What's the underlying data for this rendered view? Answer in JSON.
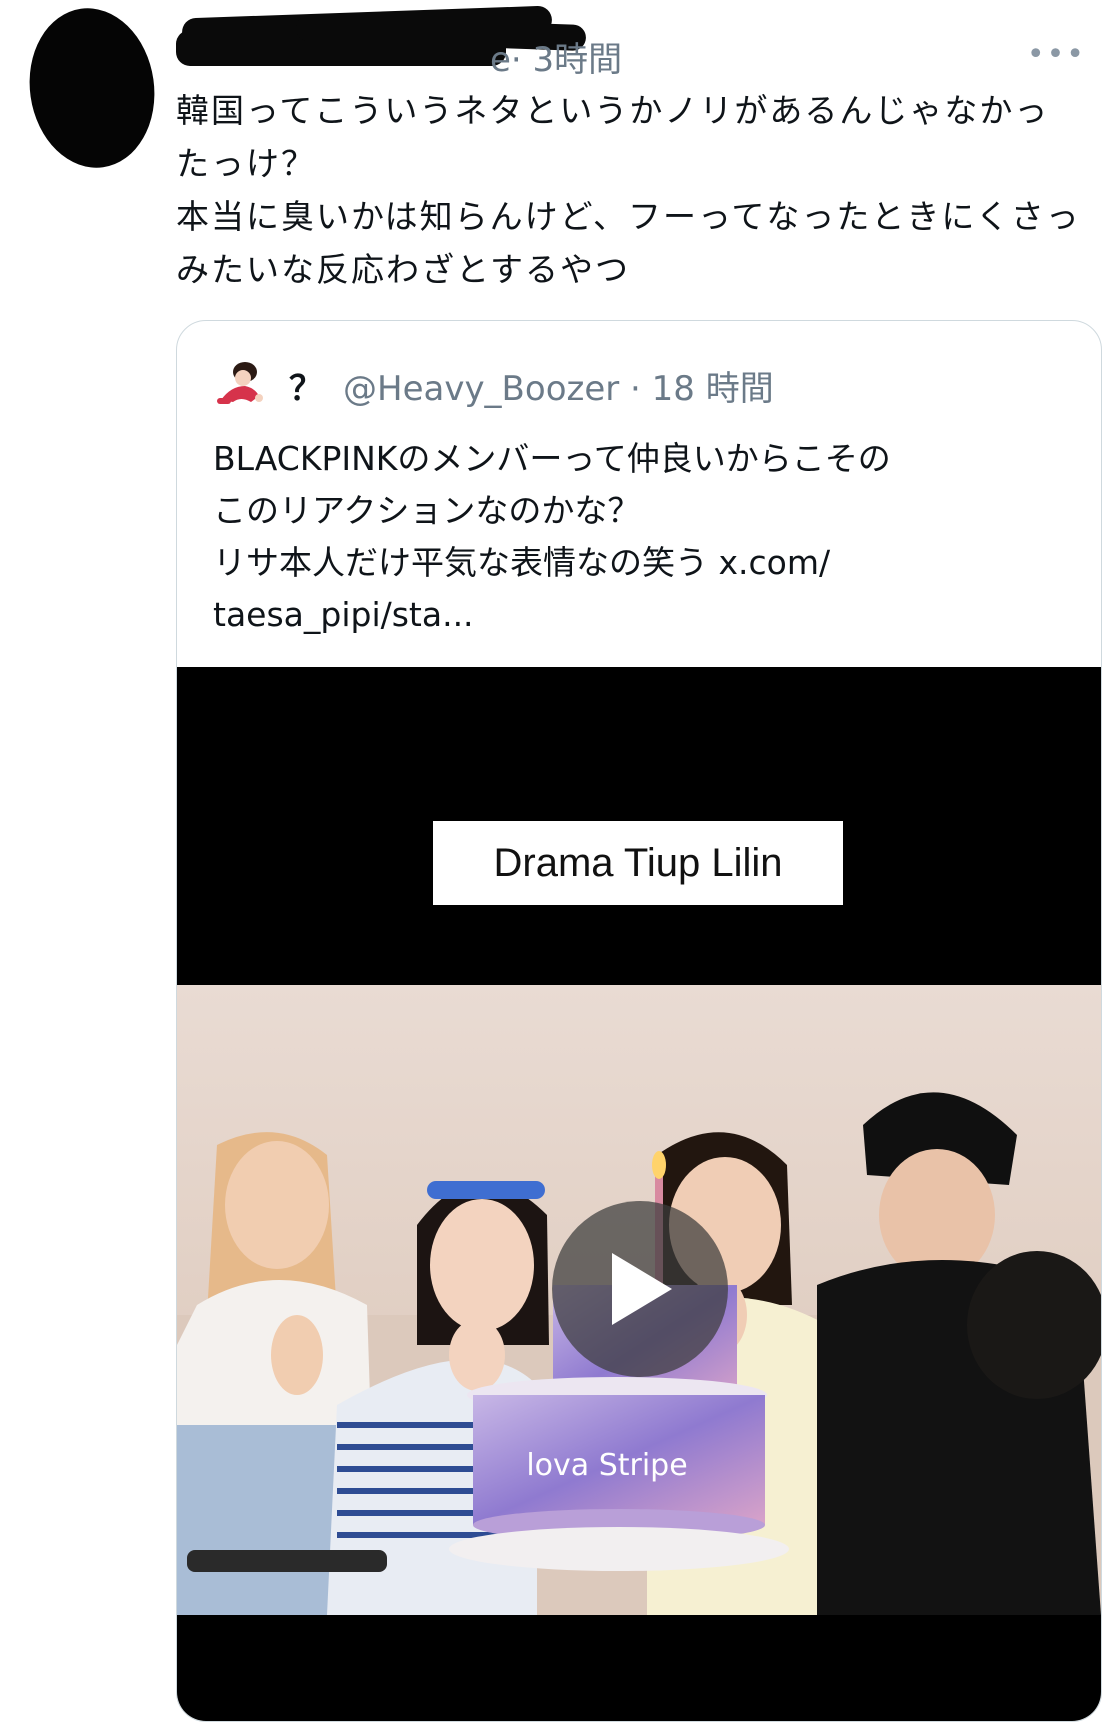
{
  "tweet": {
    "username_visible": "e",
    "meta": "· 3時間",
    "more": "•••",
    "text": "韓国ってこういうネタというかノリがあるんじゃなかったっけ？\n本当に臭いかは知らんけど、フーってなったときにくさっみたいな反応わざとするやつ"
  },
  "quoted": {
    "display_name": "？",
    "handle_time": "@Heavy_Boozer · 18 時間",
    "text": "BLACKPINKのメンバーって仲良いからこその\nこのリアクションなのかな？\nリサ本人だけ平気な表情なの笑う x.com/\ntaesa_pipi/sta...",
    "media": {
      "caption": "Drama Tiup Lilin",
      "cake_text": "lova Stripe"
    }
  },
  "colors": {
    "text": "#0f1419",
    "secondary": "#6b7a88",
    "border": "#cfd9de",
    "media_bg": "#000000"
  },
  "icons": [
    "redacted-avatar",
    "more-icon",
    "quoted-avatar",
    "play-icon"
  ]
}
